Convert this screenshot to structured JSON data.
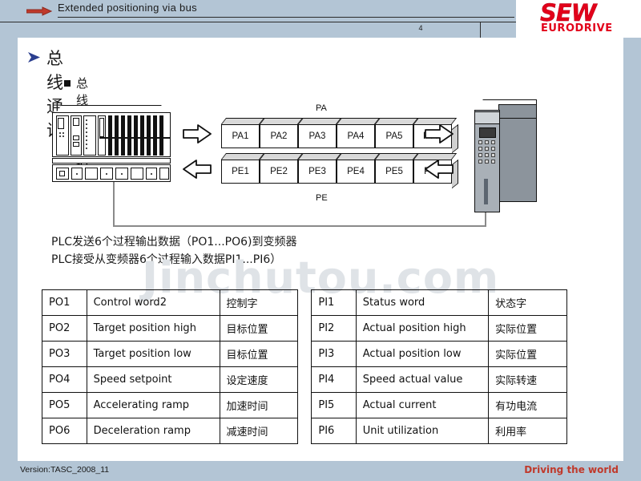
{
  "header": {
    "title": "Extended positioning via bus",
    "page_number": "4",
    "arrow_icon": "red-arrow-right-icon",
    "logo_primary": "SEW",
    "logo_secondary": "EURODRIVE",
    "logo_color": "#e2001a"
  },
  "slide": {
    "title": "总线通讯",
    "title_bullet_icon": "blue-triangle-bullet-icon",
    "subtitle": "总线过程数据",
    "subtitle_bullet_icon": "black-square-bullet-icon"
  },
  "diagram": {
    "plc_label": "plc-rack",
    "drive_label": "inverter-drive",
    "pa_group_label": "PA",
    "pe_group_label": "PE",
    "pa_cells": [
      "PA1",
      "PA2",
      "PA3",
      "PA4",
      "PA5",
      "P A6"
    ],
    "pe_cells": [
      "PE1",
      "PE2",
      "PE3",
      "PE4",
      "PE5",
      "PE6"
    ],
    "arrow_out_icon": "hollow-arrow-right-icon",
    "arrow_in_icon": "hollow-arrow-left-icon"
  },
  "description": {
    "line1": "PLC发送6个过程输出数据（PO1...PO6)到变频器",
    "line2": "PLC接受从变频器6个过程输入数据PI1...PI6）"
  },
  "watermark": {
    "text": "Jinchutou.com"
  },
  "table": {
    "rows": [
      {
        "po": "PO1",
        "po_en": "Control word2",
        "po_cn": "控制字",
        "pi": "PI1",
        "pi_en": "Status word",
        "pi_cn": "状态字"
      },
      {
        "po": "PO2",
        "po_en": "Target position high",
        "po_cn": "目标位置",
        "pi": "PI2",
        "pi_en": "Actual position high",
        "pi_cn": "实际位置"
      },
      {
        "po": "PO3",
        "po_en": "Target position low",
        "po_cn": "目标位置",
        "pi": "PI3",
        "pi_en": "Actual position low",
        "pi_cn": "实际位置"
      },
      {
        "po": "PO4",
        "po_en": "Speed setpoint",
        "po_cn": "设定速度",
        "pi": "PI4",
        "pi_en": "Speed actual value",
        "pi_cn": "实际转速"
      },
      {
        "po": "PO5",
        "po_en": "Accelerating ramp",
        "po_cn": "加速时间",
        "pi": "PI5",
        "pi_en": "Actual current",
        "pi_cn": "有功电流"
      },
      {
        "po": "PO6",
        "po_en": "Deceleration ramp",
        "po_cn": "减速时间",
        "pi": "PI6",
        "pi_en": "Unit utilization",
        "pi_cn": "利用率"
      }
    ]
  },
  "footer": {
    "version": "Version:TASC_2008_11",
    "slogan": "Driving the world",
    "slogan_color": "#c0392b"
  }
}
